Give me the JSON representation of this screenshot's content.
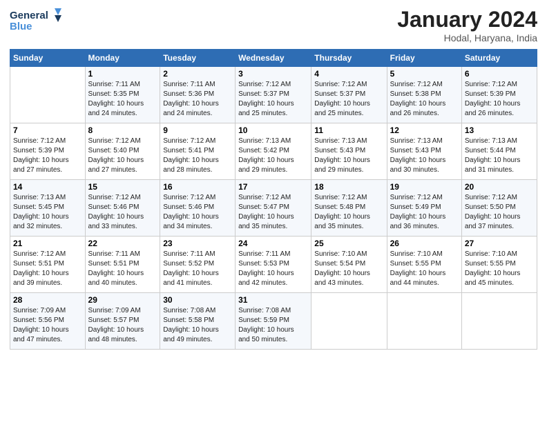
{
  "header": {
    "logo_line1": "General",
    "logo_line2": "Blue",
    "title": "January 2024",
    "subtitle": "Hodal, Haryana, India"
  },
  "days_header": [
    "Sunday",
    "Monday",
    "Tuesday",
    "Wednesday",
    "Thursday",
    "Friday",
    "Saturday"
  ],
  "weeks": [
    [
      {
        "num": "",
        "info": ""
      },
      {
        "num": "1",
        "info": "Sunrise: 7:11 AM\nSunset: 5:35 PM\nDaylight: 10 hours\nand 24 minutes."
      },
      {
        "num": "2",
        "info": "Sunrise: 7:11 AM\nSunset: 5:36 PM\nDaylight: 10 hours\nand 24 minutes."
      },
      {
        "num": "3",
        "info": "Sunrise: 7:12 AM\nSunset: 5:37 PM\nDaylight: 10 hours\nand 25 minutes."
      },
      {
        "num": "4",
        "info": "Sunrise: 7:12 AM\nSunset: 5:37 PM\nDaylight: 10 hours\nand 25 minutes."
      },
      {
        "num": "5",
        "info": "Sunrise: 7:12 AM\nSunset: 5:38 PM\nDaylight: 10 hours\nand 26 minutes."
      },
      {
        "num": "6",
        "info": "Sunrise: 7:12 AM\nSunset: 5:39 PM\nDaylight: 10 hours\nand 26 minutes."
      }
    ],
    [
      {
        "num": "7",
        "info": "Sunrise: 7:12 AM\nSunset: 5:39 PM\nDaylight: 10 hours\nand 27 minutes."
      },
      {
        "num": "8",
        "info": "Sunrise: 7:12 AM\nSunset: 5:40 PM\nDaylight: 10 hours\nand 27 minutes."
      },
      {
        "num": "9",
        "info": "Sunrise: 7:12 AM\nSunset: 5:41 PM\nDaylight: 10 hours\nand 28 minutes."
      },
      {
        "num": "10",
        "info": "Sunrise: 7:13 AM\nSunset: 5:42 PM\nDaylight: 10 hours\nand 29 minutes."
      },
      {
        "num": "11",
        "info": "Sunrise: 7:13 AM\nSunset: 5:43 PM\nDaylight: 10 hours\nand 29 minutes."
      },
      {
        "num": "12",
        "info": "Sunrise: 7:13 AM\nSunset: 5:43 PM\nDaylight: 10 hours\nand 30 minutes."
      },
      {
        "num": "13",
        "info": "Sunrise: 7:13 AM\nSunset: 5:44 PM\nDaylight: 10 hours\nand 31 minutes."
      }
    ],
    [
      {
        "num": "14",
        "info": "Sunrise: 7:13 AM\nSunset: 5:45 PM\nDaylight: 10 hours\nand 32 minutes."
      },
      {
        "num": "15",
        "info": "Sunrise: 7:12 AM\nSunset: 5:46 PM\nDaylight: 10 hours\nand 33 minutes."
      },
      {
        "num": "16",
        "info": "Sunrise: 7:12 AM\nSunset: 5:46 PM\nDaylight: 10 hours\nand 34 minutes."
      },
      {
        "num": "17",
        "info": "Sunrise: 7:12 AM\nSunset: 5:47 PM\nDaylight: 10 hours\nand 35 minutes."
      },
      {
        "num": "18",
        "info": "Sunrise: 7:12 AM\nSunset: 5:48 PM\nDaylight: 10 hours\nand 35 minutes."
      },
      {
        "num": "19",
        "info": "Sunrise: 7:12 AM\nSunset: 5:49 PM\nDaylight: 10 hours\nand 36 minutes."
      },
      {
        "num": "20",
        "info": "Sunrise: 7:12 AM\nSunset: 5:50 PM\nDaylight: 10 hours\nand 37 minutes."
      }
    ],
    [
      {
        "num": "21",
        "info": "Sunrise: 7:12 AM\nSunset: 5:51 PM\nDaylight: 10 hours\nand 39 minutes."
      },
      {
        "num": "22",
        "info": "Sunrise: 7:11 AM\nSunset: 5:51 PM\nDaylight: 10 hours\nand 40 minutes."
      },
      {
        "num": "23",
        "info": "Sunrise: 7:11 AM\nSunset: 5:52 PM\nDaylight: 10 hours\nand 41 minutes."
      },
      {
        "num": "24",
        "info": "Sunrise: 7:11 AM\nSunset: 5:53 PM\nDaylight: 10 hours\nand 42 minutes."
      },
      {
        "num": "25",
        "info": "Sunrise: 7:10 AM\nSunset: 5:54 PM\nDaylight: 10 hours\nand 43 minutes."
      },
      {
        "num": "26",
        "info": "Sunrise: 7:10 AM\nSunset: 5:55 PM\nDaylight: 10 hours\nand 44 minutes."
      },
      {
        "num": "27",
        "info": "Sunrise: 7:10 AM\nSunset: 5:55 PM\nDaylight: 10 hours\nand 45 minutes."
      }
    ],
    [
      {
        "num": "28",
        "info": "Sunrise: 7:09 AM\nSunset: 5:56 PM\nDaylight: 10 hours\nand 47 minutes."
      },
      {
        "num": "29",
        "info": "Sunrise: 7:09 AM\nSunset: 5:57 PM\nDaylight: 10 hours\nand 48 minutes."
      },
      {
        "num": "30",
        "info": "Sunrise: 7:08 AM\nSunset: 5:58 PM\nDaylight: 10 hours\nand 49 minutes."
      },
      {
        "num": "31",
        "info": "Sunrise: 7:08 AM\nSunset: 5:59 PM\nDaylight: 10 hours\nand 50 minutes."
      },
      {
        "num": "",
        "info": ""
      },
      {
        "num": "",
        "info": ""
      },
      {
        "num": "",
        "info": ""
      }
    ]
  ]
}
